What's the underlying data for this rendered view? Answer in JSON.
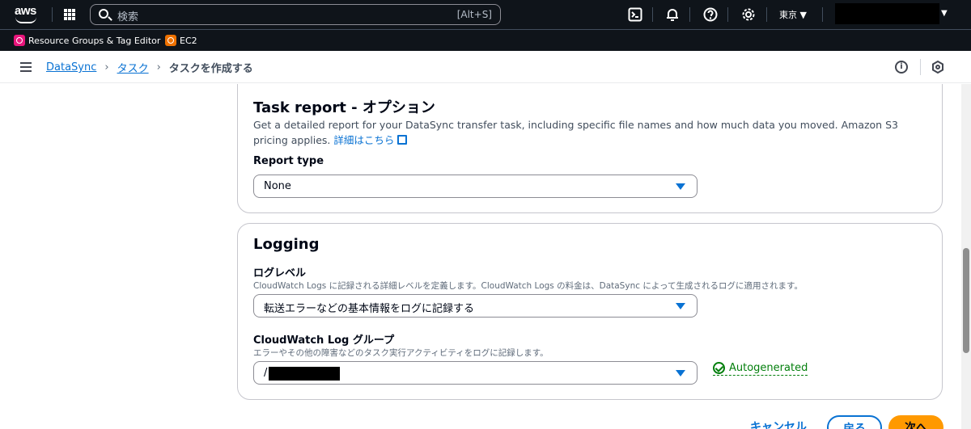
{
  "topnav": {
    "logo": "aws",
    "search_placeholder": "検索",
    "search_shortcut": "[Alt+S]",
    "region": "東京 ▼",
    "icons": [
      "services-grid-icon",
      "search-icon",
      "cloudshell-icon",
      "bell-icon",
      "help-icon",
      "gear-icon"
    ]
  },
  "favorites": [
    {
      "label": "Resource Groups & Tag Editor",
      "icon": "resource-groups-icon",
      "color": "#e7157b"
    },
    {
      "label": "EC2",
      "icon": "ec2-icon",
      "color": "#ed7100"
    }
  ],
  "breadcrumb": {
    "items": [
      "DataSync",
      "タスク"
    ],
    "current": "タスクを作成する"
  },
  "task_report": {
    "title": "Task report - オプション",
    "description": "Get a detailed report for your DataSync transfer task, including specific file names and how much data you moved. Amazon S3 pricing applies.",
    "link": "詳細はこちら",
    "report_type_label": "Report type",
    "report_type_value": "None"
  },
  "logging": {
    "title": "Logging",
    "log_level_label": "ログレベル",
    "log_level_desc": "CloudWatch Logs に記録される詳細レベルを定義します。CloudWatch Logs の料金は、DataSync によって生成されるログに適用されます。",
    "log_level_value": "転送エラーなどの基本情報をログに記録する",
    "log_group_label": "CloudWatch Log グループ",
    "log_group_desc": "エラーやその他の障害などのタスク実行アクティビティをログに記録します。",
    "log_group_value": "/",
    "autogenerated": "Autogenerated"
  },
  "actions": {
    "cancel": "キャンセル",
    "back": "戻る",
    "next": "次へ"
  },
  "colors": {
    "nav_bg": "#0f141a",
    "link": "#0972d3",
    "primary": "#ff9900",
    "success": "#037f0c"
  }
}
